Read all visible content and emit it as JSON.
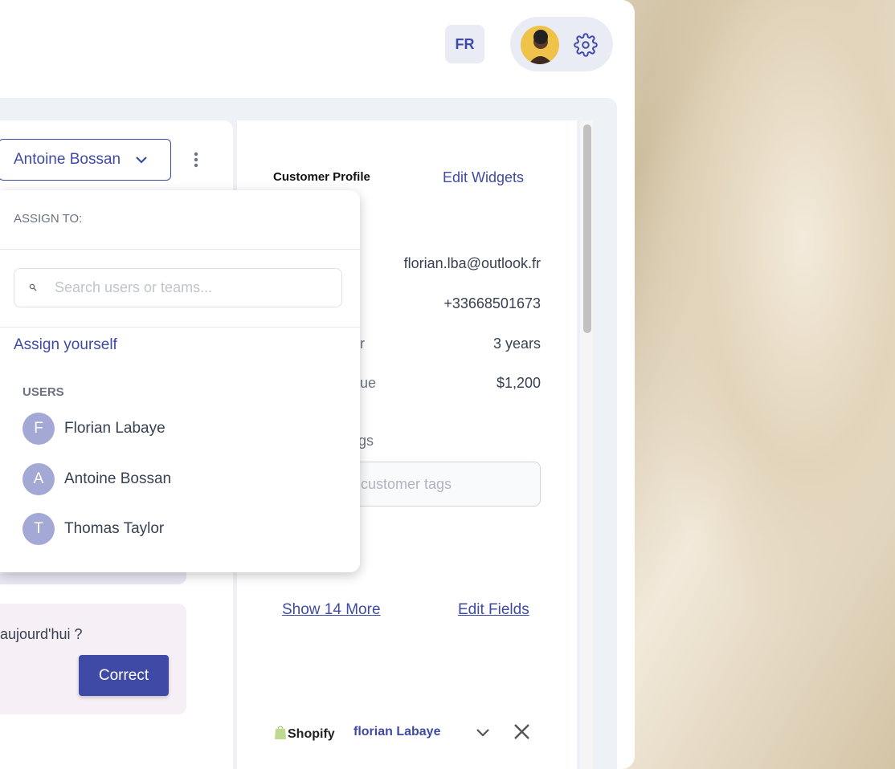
{
  "header": {
    "language": "FR",
    "settings_icon": "gear-icon",
    "avatar": "user-avatar"
  },
  "conversation": {
    "assignee": "Antoine Bossan",
    "message_fragment": "aujourd'hui ?",
    "correct_button": "Correct"
  },
  "assign_popup": {
    "title": "ASSIGN TO:",
    "search_placeholder": "Search users or teams...",
    "assign_yourself": "Assign yourself",
    "users_heading": "USERS",
    "users": [
      {
        "initial": "F",
        "name": "Florian Labaye"
      },
      {
        "initial": "A",
        "name": "Antoine Bossan"
      },
      {
        "initial": "T",
        "name": "Thomas Taylor"
      }
    ]
  },
  "customer_profile": {
    "title": "Customer Profile",
    "edit_widgets": "Edit Widgets",
    "email": "florian.lba@outlook.fr",
    "phone": "+33668501673",
    "customer_for_label_fragment": "r",
    "customer_for": "3 years",
    "value_label_fragment": "ue",
    "value": "$1,200",
    "tags_label_fragment": "gs",
    "tags_placeholder_fragment": "customer tags",
    "show_more": "Show 14 More",
    "edit_fields": "Edit Fields"
  },
  "integration": {
    "name": "Shopify",
    "customer": "florian Labaye",
    "brand_color": "#95bf47"
  },
  "colors": {
    "accent": "#3f4aa6",
    "avatar_bg": "#a4a8d4"
  }
}
